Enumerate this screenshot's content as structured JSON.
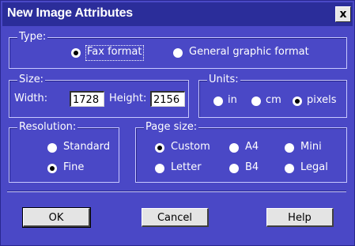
{
  "window": {
    "title": "New Image Attributes",
    "close_label": "x"
  },
  "type_group": {
    "legend": "Type:",
    "options": [
      {
        "label": "Fax format",
        "selected": true
      },
      {
        "label": "General graphic format",
        "selected": false
      }
    ]
  },
  "size_group": {
    "legend": "Size:",
    "width_label": "Width:",
    "width_value": "1728",
    "height_label": "Height:",
    "height_value": "2156"
  },
  "units_group": {
    "legend": "Units:",
    "options": [
      {
        "label": "in",
        "selected": false
      },
      {
        "label": "cm",
        "selected": false
      },
      {
        "label": "pixels",
        "selected": true
      }
    ]
  },
  "resolution_group": {
    "legend": "Resolution:",
    "options": [
      {
        "label": "Standard",
        "selected": false
      },
      {
        "label": "Fine",
        "selected": true
      }
    ]
  },
  "page_size_group": {
    "legend": "Page size:",
    "options": [
      {
        "label": "Custom",
        "selected": true
      },
      {
        "label": "A4",
        "selected": false
      },
      {
        "label": "Mini",
        "selected": false
      },
      {
        "label": "Letter",
        "selected": false
      },
      {
        "label": "B4",
        "selected": false
      },
      {
        "label": "Legal",
        "selected": false
      }
    ]
  },
  "buttons": {
    "ok": "OK",
    "cancel": "Cancel",
    "help": "Help"
  },
  "colors": {
    "dialog_bg": "#4a48c6",
    "titlebar_bg": "#2b2d9a",
    "text": "#ffffff"
  }
}
